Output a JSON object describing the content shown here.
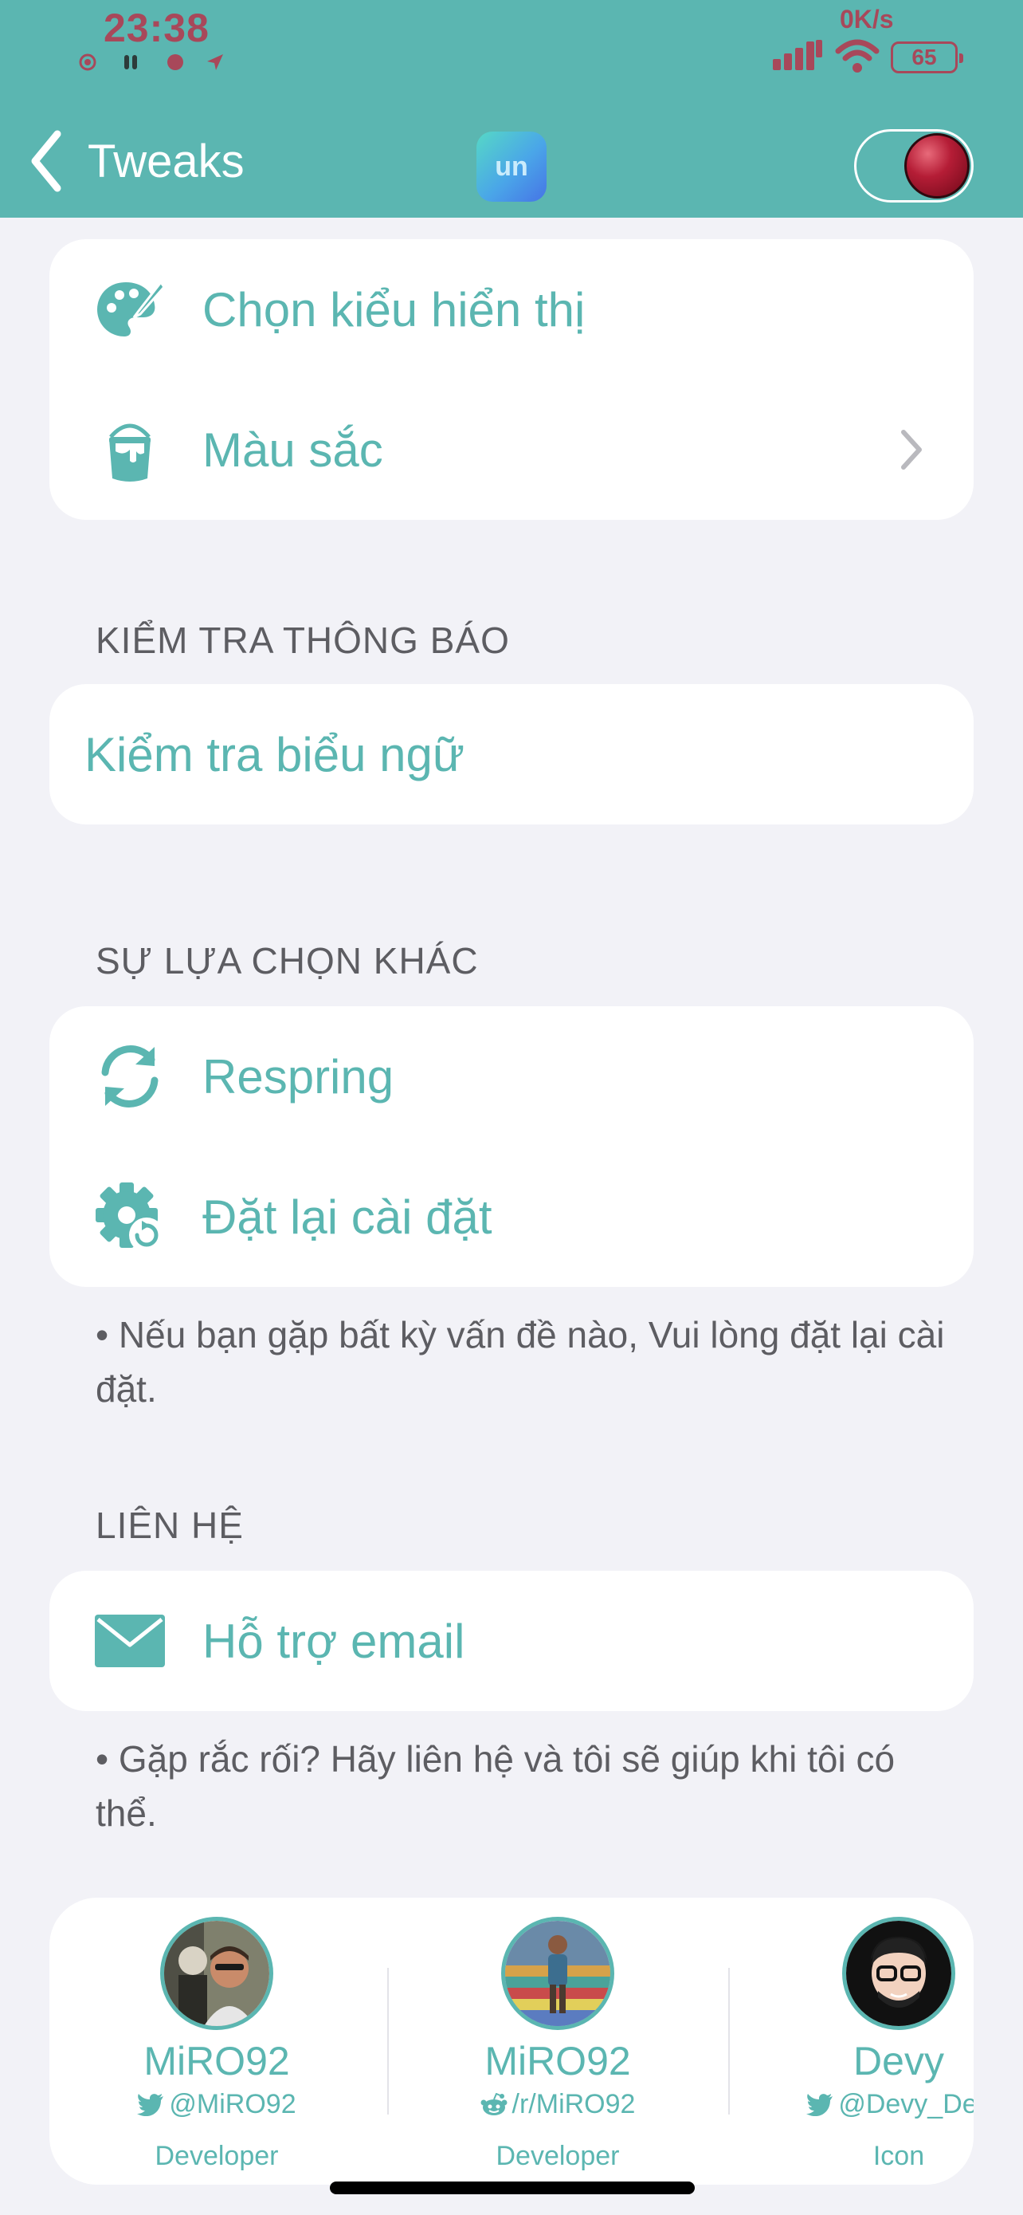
{
  "status_bar": {
    "time": "23:38",
    "speed": "0K/s",
    "battery": "65"
  },
  "nav": {
    "back_label": "Tweaks",
    "logo_text": "un"
  },
  "colors": {
    "accent": "#5bb6b1",
    "background": "#f2f2f7",
    "section_text": "#5d5d62",
    "status_text": "#a8485a"
  },
  "display_group": {
    "items": [
      {
        "label": "Chọn kiểu hiển thị",
        "icon": "palette-icon"
      },
      {
        "label": "Màu sắc",
        "icon": "paint-bucket-icon"
      }
    ]
  },
  "notification_test": {
    "title": "KIỂM TRA THÔNG BÁO",
    "banner_label": "Kiểm tra biểu ngữ"
  },
  "other_options": {
    "title": "SỰ LỰA CHỌN KHÁC",
    "items": [
      {
        "label": "Respring",
        "icon": "refresh-icon"
      },
      {
        "label": "Đặt lại cài đặt",
        "icon": "gear-reset-icon"
      }
    ],
    "footnote": "• Nếu bạn gặp bất kỳ vấn đề nào, Vui lòng đặt lại cài đặt."
  },
  "contact": {
    "title": "LIÊN HỆ",
    "email_label": "Hỗ trợ email",
    "footnote": "• Gặp rắc rối? Hãy liên hệ và tôi sẽ giúp khi tôi có thể."
  },
  "team": [
    {
      "name": "MiRO92",
      "handle": "@MiRO92",
      "platform": "twitter-icon",
      "role": "Developer"
    },
    {
      "name": "MiRO92",
      "handle": "/r/MiRO92",
      "platform": "reddit-icon",
      "role": "Developer"
    },
    {
      "name": "Devy",
      "handle": "@Devy_Des",
      "platform": "twitter-icon",
      "role": "Icon"
    }
  ]
}
